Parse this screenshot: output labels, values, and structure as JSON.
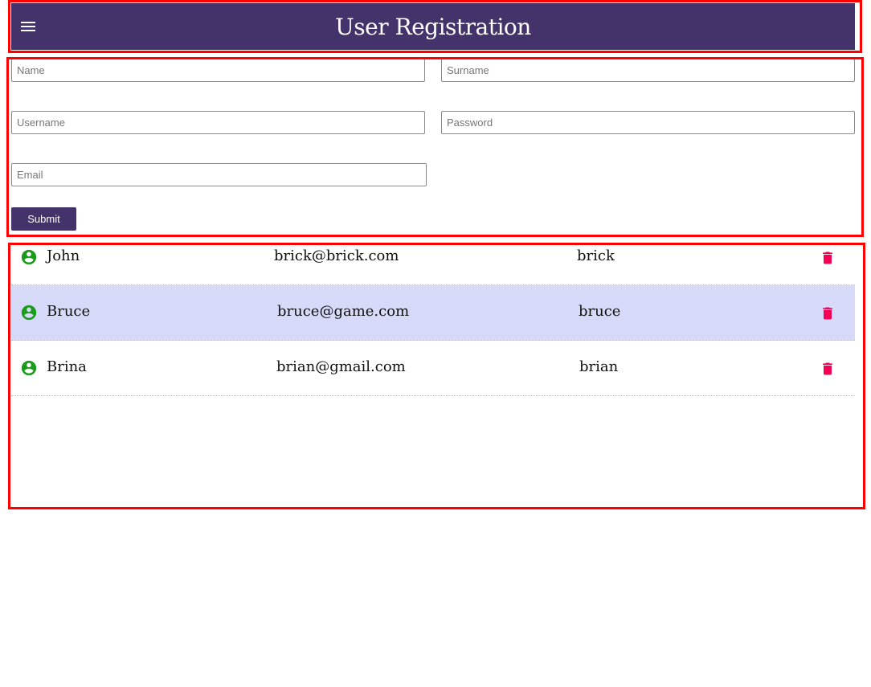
{
  "header": {
    "title": "User Registration",
    "menu_icon": "menu-icon",
    "background": "#44336b"
  },
  "form": {
    "name_placeholder": "Name",
    "surname_placeholder": "Surname",
    "username_placeholder": "Username",
    "password_placeholder": "Password",
    "email_placeholder": "Email",
    "submit_label": "Submit",
    "accent": "#44336b"
  },
  "users": [
    {
      "name": "John",
      "email": "brick@brick.com",
      "username": "brick",
      "avatar_icon": "account-circle-icon",
      "delete_icon": "trash-icon",
      "highlighted": false
    },
    {
      "name": "Bruce",
      "email": "bruce@game.com",
      "username": "bruce",
      "avatar_icon": "account-circle-icon",
      "delete_icon": "trash-icon",
      "highlighted": true
    },
    {
      "name": "Brina",
      "email": "brian@gmail.com",
      "username": "brian",
      "avatar_icon": "account-circle-icon",
      "delete_icon": "trash-icon",
      "highlighted": false
    }
  ],
  "colors": {
    "avatar": "#1a9c1a",
    "delete": "#f50057",
    "row_highlight": "#d6d9f8",
    "outline": "#ff0000"
  }
}
